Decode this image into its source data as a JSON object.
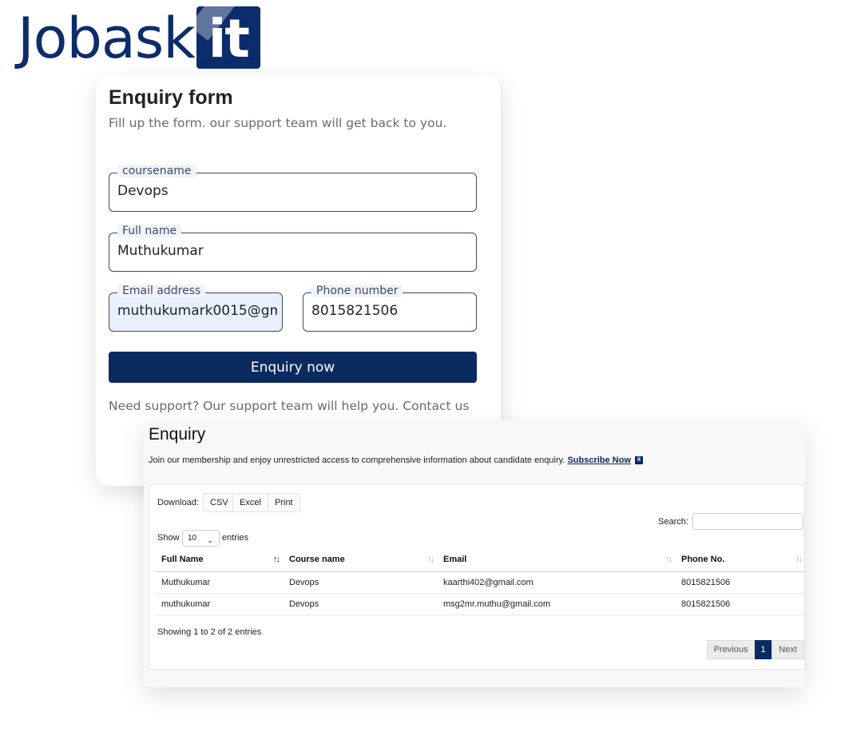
{
  "logo": {
    "text": "Jobask",
    "badge": "it"
  },
  "form": {
    "title": "Enquiry form",
    "subtitle": "Fill up the form. our support team will get back to you.",
    "fields": {
      "course": {
        "label": "coursename",
        "value": "Devops"
      },
      "fullname": {
        "label": "Full name",
        "value": "Muthukumar"
      },
      "email": {
        "label": "Email address",
        "value": "muthukumark0015@gm"
      },
      "phone": {
        "label": "Phone number",
        "value": "8015821506"
      }
    },
    "submit_label": "Enquiry now",
    "support_text": "Need support? Our support team will help you. Contact us"
  },
  "enquiry": {
    "title": "Enquiry",
    "description": "Join our membership and enjoy unrestricted access to comprehensive information about candidate enquiry.",
    "subscribe_link": "Subscribe Now",
    "subscribe_badge": "it",
    "download_label": "Download:",
    "download_buttons": [
      "CSV",
      "Excel",
      "Print"
    ],
    "search_label": "Search:",
    "show_label": "Show",
    "page_size": "10",
    "entries_label": "entries",
    "columns": [
      "Full Name",
      "Course name",
      "Email",
      "Phone No."
    ],
    "rows": [
      [
        "Muthukumar",
        "Devops",
        "kaarthi402@gmail.com",
        "8015821506"
      ],
      [
        "muthukumar",
        "Devops",
        "msg2mr.muthu@gmail.com",
        "8015821506"
      ]
    ],
    "info": "Showing 1 to 2 of 2 entries",
    "pagination": {
      "previous": "Previous",
      "current": "1",
      "next": "Next"
    },
    "sort_icons": {
      "active": "↑↓",
      "inactive": "↑↓"
    }
  },
  "colors": {
    "brand": "#0d2c6b",
    "button": "#0b2a60",
    "autofill": "#e8f0fe"
  }
}
